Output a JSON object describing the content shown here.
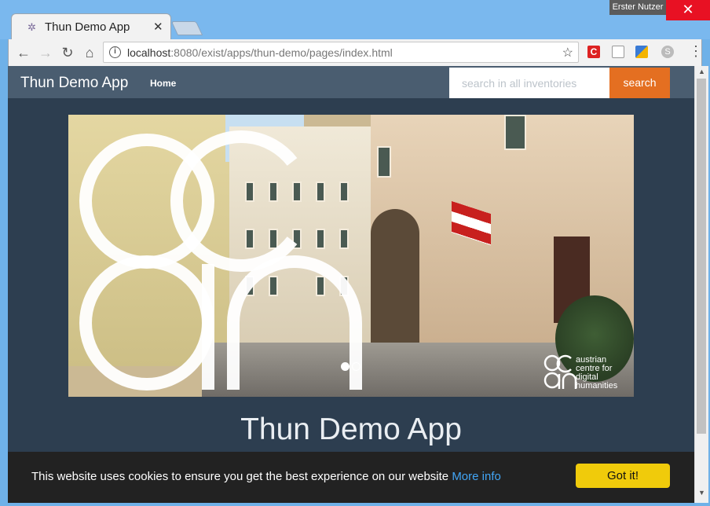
{
  "window": {
    "user_label": "Erster Nutzer",
    "close_glyph": "✕"
  },
  "tab": {
    "title": "Thun Demo App",
    "close_glyph": "✕",
    "favicon": "puzzle-favicon"
  },
  "toolbar": {
    "back_glyph": "←",
    "forward_glyph": "→",
    "reload_glyph": "↻",
    "home_glyph": "⌂",
    "url_host": "localhost",
    "url_rest": ":8080/exist/apps/thun-demo/pages/index.html",
    "star_glyph": "☆",
    "ext_c_label": "C",
    "menu_glyph": "⋮",
    "skype_label": "S"
  },
  "navbar": {
    "brand": "Thun Demo App",
    "home_label": "Home",
    "search_placeholder": "search in all inventories",
    "search_button": "search"
  },
  "hero": {
    "acdh_caption_1": "austrian",
    "acdh_caption_2": "centre for",
    "acdh_caption_3": "digital",
    "acdh_caption_4": "humanities",
    "slide_count": 2,
    "active_slide": 1
  },
  "main": {
    "title": "Thun Demo App"
  },
  "cookie": {
    "message": "This website uses cookies to ensure you get the best experience on our website",
    "link_label": "More info",
    "button_label": "Got it!"
  },
  "colors": {
    "accent": "#e46f21",
    "navbar": "#4a5d70",
    "page_bg": "#2d3e50",
    "cookie_button": "#f0cb0b",
    "link": "#42a5f5"
  }
}
